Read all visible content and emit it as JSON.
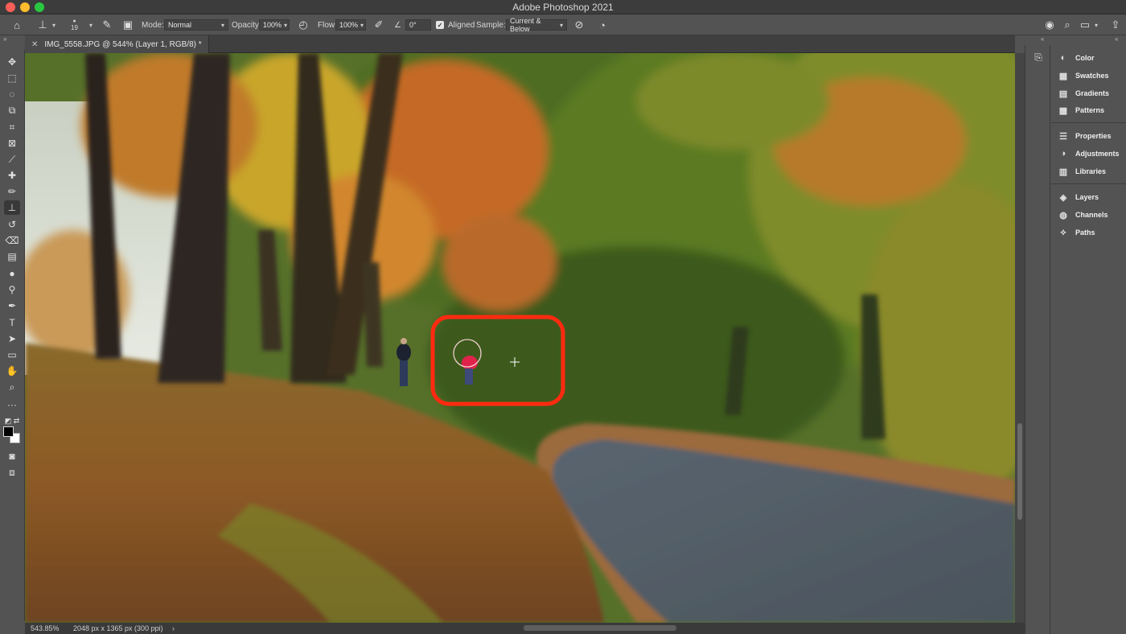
{
  "window": {
    "title": "Adobe Photoshop 2021"
  },
  "options": {
    "brush_size": "19",
    "mode_label": "Mode:",
    "mode_value": "Normal",
    "opacity_label": "Opacity:",
    "opacity_value": "100%",
    "flow_label": "Flow:",
    "flow_value": "100%",
    "angle_value": "0°",
    "aligned_label": "Aligned",
    "sample_label": "Sample:",
    "sample_value": "Current & Below"
  },
  "document": {
    "tab_title": "IMG_5558.JPG @ 544% (Layer 1, RGB/8) *"
  },
  "status": {
    "zoom": "543.85%",
    "doc_info": "2048 px x 1365 px (300 ppi)",
    "arrow": "›"
  },
  "panels": [
    {
      "label": "Color",
      "icon": "color-icon"
    },
    {
      "label": "Swatches",
      "icon": "swatches-icon"
    },
    {
      "label": "Gradients",
      "icon": "gradients-icon"
    },
    {
      "label": "Patterns",
      "icon": "patterns-icon"
    },
    {
      "label": "Properties",
      "icon": "properties-icon"
    },
    {
      "label": "Adjustments",
      "icon": "adjustments-icon"
    },
    {
      "label": "Libraries",
      "icon": "libraries-icon"
    },
    {
      "label": "Layers",
      "icon": "layers-icon"
    },
    {
      "label": "Channels",
      "icon": "channels-icon"
    },
    {
      "label": "Paths",
      "icon": "paths-icon"
    }
  ],
  "tools": [
    "move-tool-icon",
    "marquee-tool-icon",
    "lasso-tool-icon",
    "object-select-tool-icon",
    "crop-tool-icon",
    "frame-tool-icon",
    "eyedropper-tool-icon",
    "healing-brush-tool-icon",
    "brush-tool-icon",
    "clone-stamp-tool-icon",
    "history-brush-tool-icon",
    "eraser-tool-icon",
    "gradient-tool-icon",
    "blur-tool-icon",
    "dodge-tool-icon",
    "pen-tool-icon",
    "type-tool-icon",
    "path-select-tool-icon",
    "rectangle-tool-icon",
    "hand-tool-icon",
    "zoom-tool-icon",
    "more-tools-icon"
  ],
  "colors": {
    "annotation_red": "#ff2a10",
    "foreground": "#000000",
    "background": "#ffffff"
  }
}
